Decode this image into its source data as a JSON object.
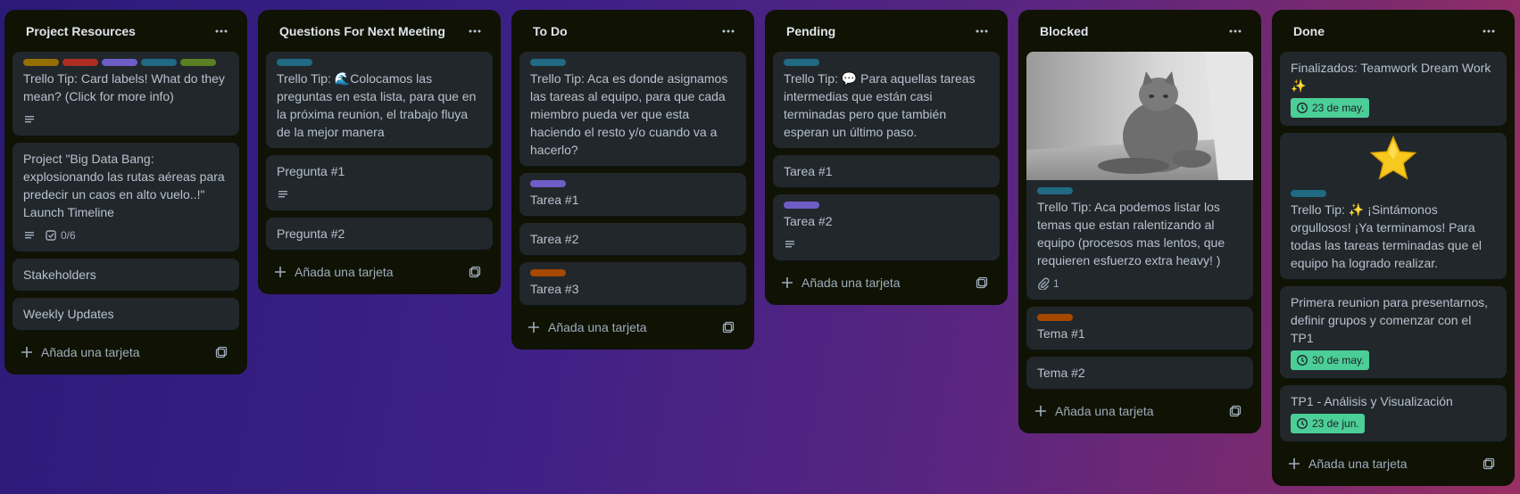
{
  "colors": {
    "list_bg": "#101204",
    "card_bg": "#22272b",
    "label_yellow": "#946f00",
    "label_red": "#ae2e24",
    "label_purple": "#6e5dc6",
    "label_teal": "#206a83",
    "label_green": "#5b7f24",
    "label_orange": "#a54800",
    "date_green": "#4bce97"
  },
  "add_card_label": "Añada una tarjeta",
  "lists": [
    {
      "title": "Project Resources",
      "cards": [
        {
          "text": "Trello Tip: Card labels! What do they mean? (Click for more info)"
        },
        {
          "text": "Project \"Big Data Bang: explosionando las rutas aéreas para predecir un caos en alto vuelo..!\" Launch Timeline",
          "checklist": "0/6"
        },
        {
          "text": "Stakeholders"
        },
        {
          "text": "Weekly Updates"
        }
      ]
    },
    {
      "title": "Questions For Next Meeting",
      "cards": [
        {
          "text": "Trello Tip: 🌊Colocamos las preguntas en esta lista, para que en la próxima reunion, el trabajo fluya de la mejor manera"
        },
        {
          "text": "Pregunta #1"
        },
        {
          "text": "Pregunta #2"
        }
      ]
    },
    {
      "title": "To Do",
      "cards": [
        {
          "text": "Trello Tip: Aca es donde asignamos las tareas al equipo, para que cada miembro pueda ver que esta haciendo el resto y/o cuando va a hacerlo?"
        },
        {
          "text": "Tarea #1"
        },
        {
          "text": "Tarea #2"
        },
        {
          "text": "Tarea #3"
        }
      ]
    },
    {
      "title": "Pending",
      "cards": [
        {
          "text": "Trello Tip: 💬 Para aquellas tareas intermedias que están casi terminadas pero que también esperan un último paso."
        },
        {
          "text": "Tarea #1"
        },
        {
          "text": "Tarea #2"
        }
      ]
    },
    {
      "title": "Blocked",
      "cards": [
        {
          "text": "Trello Tip: Aca podemos listar los temas que estan ralentizando al equipo (procesos mas lentos, que requieren esfuerzo extra heavy! )",
          "attachments": "1"
        },
        {
          "text": "Tema #1"
        },
        {
          "text": "Tema #2"
        }
      ]
    },
    {
      "title": "Done",
      "cards": [
        {
          "text": "Finalizados: Teamwork Dream Work ✨",
          "date": "23 de may."
        },
        {
          "text": "Trello Tip: ✨ ¡Sintámonos orgullosos! ¡Ya terminamos! Para todas las tareas terminadas que el equipo ha logrado realizar."
        },
        {
          "text": "Primera reunion para presentarnos, definir grupos y comenzar con el TP1",
          "date": "30 de may."
        },
        {
          "text": "TP1 - Análisis y Visualización",
          "date": "23 de jun."
        }
      ]
    }
  ]
}
